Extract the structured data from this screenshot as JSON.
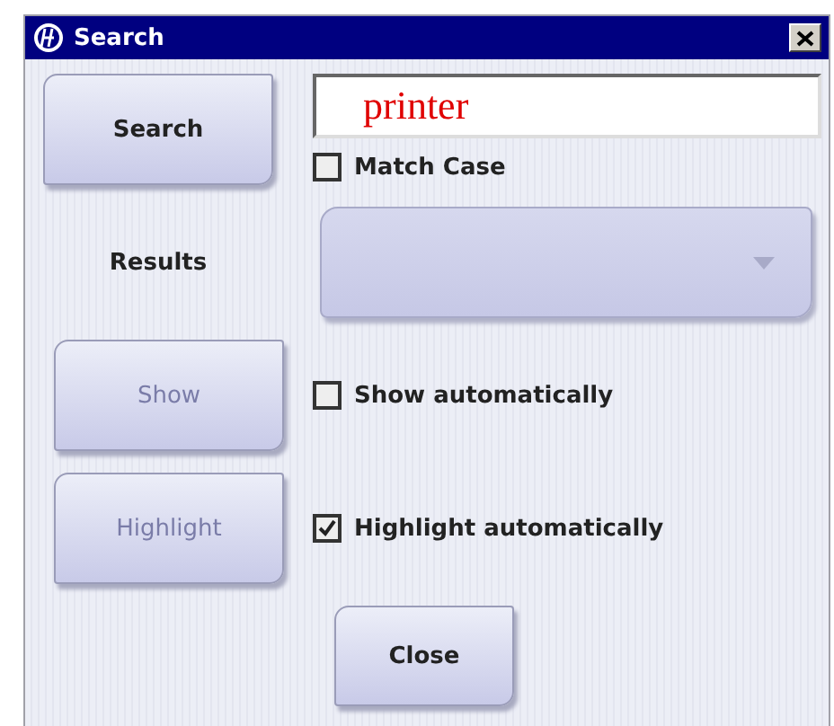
{
  "window": {
    "title": "Search"
  },
  "search_button": {
    "label": "Search",
    "disabled": false
  },
  "query": {
    "value": "printer"
  },
  "match_case": {
    "label": "Match Case",
    "checked": false
  },
  "results": {
    "label": "Results"
  },
  "actions": [
    {
      "label": "Show",
      "disabled": true,
      "option": {
        "label": "Show automatically",
        "checked": false
      }
    },
    {
      "label": "Highlight",
      "disabled": true,
      "option": {
        "label": "Highlight automatically",
        "checked": true
      }
    }
  ],
  "close_button": {
    "label": "Close",
    "disabled": false
  }
}
